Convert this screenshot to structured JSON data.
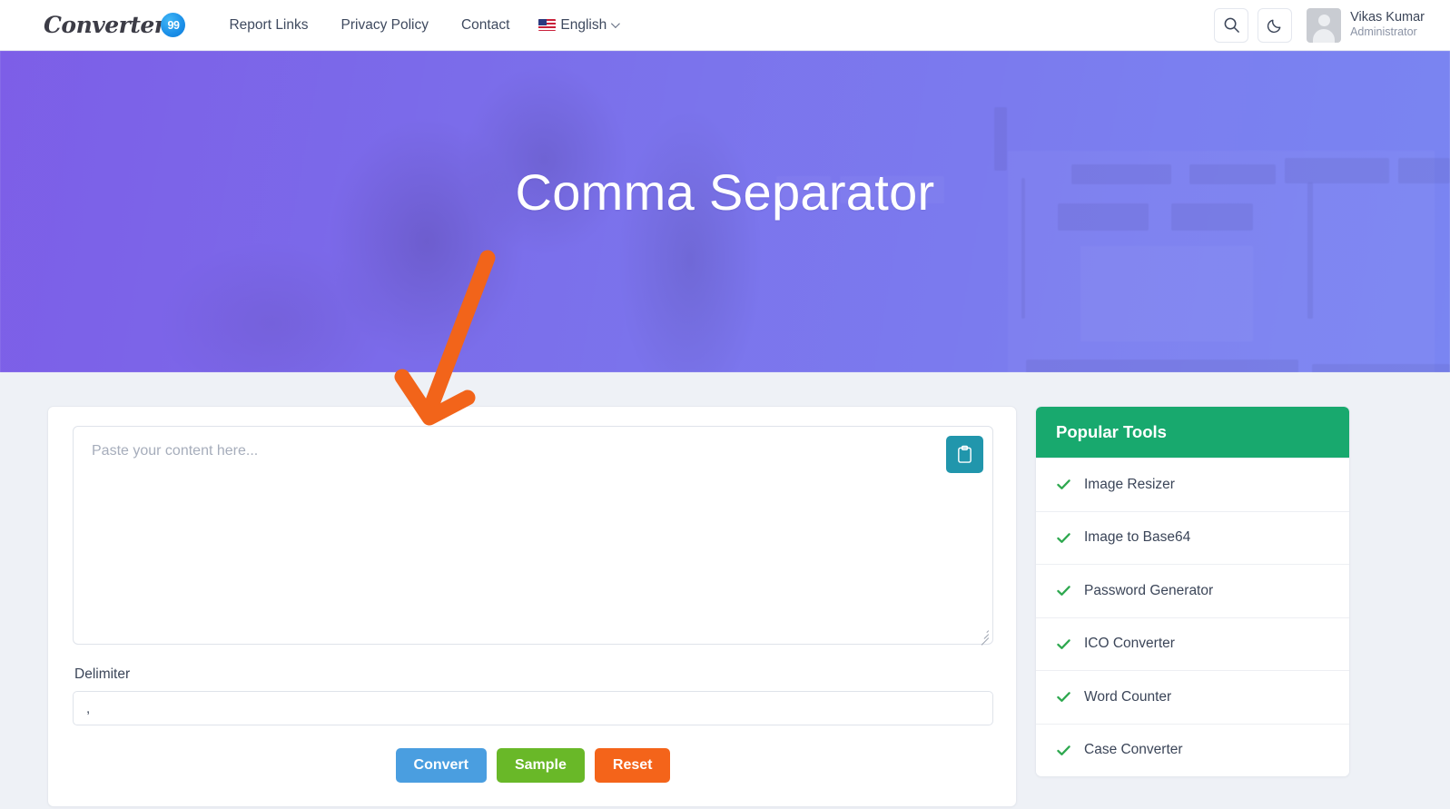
{
  "header": {
    "logo": {
      "text": "Converter",
      "badge": "99",
      "name": "converter99-logo"
    },
    "nav": [
      {
        "label": "Report Links",
        "name": "nav-report-links"
      },
      {
        "label": "Privacy Policy",
        "name": "nav-privacy-policy"
      },
      {
        "label": "Contact",
        "name": "nav-contact"
      }
    ],
    "language": {
      "label": "English",
      "flag_icon": "us-flag-icon",
      "chevron_icon": "chevron-down-icon"
    },
    "search_icon": "search-icon",
    "dark_mode_icon": "moon-icon",
    "user": {
      "name": "Vikas Kumar",
      "role": "Administrator",
      "avatar_icon": "user-avatar-icon"
    }
  },
  "hero": {
    "title": "Comma Separator"
  },
  "annotation": {
    "arrow_icon": "orange-arrow-down-icon",
    "color": "#f2641a"
  },
  "converter": {
    "textarea": {
      "value": "",
      "placeholder": "Paste your content here..."
    },
    "paste_button": {
      "icon": "clipboard-icon",
      "color": "#2196ac"
    },
    "delimiter": {
      "label": "Delimiter",
      "value": ",",
      "placeholder": ""
    },
    "buttons": [
      {
        "label": "Convert",
        "name": "convert-button",
        "color": "#4a9ee0"
      },
      {
        "label": "Sample",
        "name": "sample-button",
        "color": "#69b828"
      },
      {
        "label": "Reset",
        "name": "reset-button",
        "color": "#f4641a"
      }
    ]
  },
  "sidebar": {
    "title": "Popular Tools",
    "header_color": "#18a96e",
    "check_icon": "check-icon",
    "items": [
      {
        "label": "Image Resizer"
      },
      {
        "label": "Image to Base64"
      },
      {
        "label": "Password Generator"
      },
      {
        "label": "ICO Converter"
      },
      {
        "label": "Word Counter"
      },
      {
        "label": "Case Converter"
      }
    ]
  }
}
